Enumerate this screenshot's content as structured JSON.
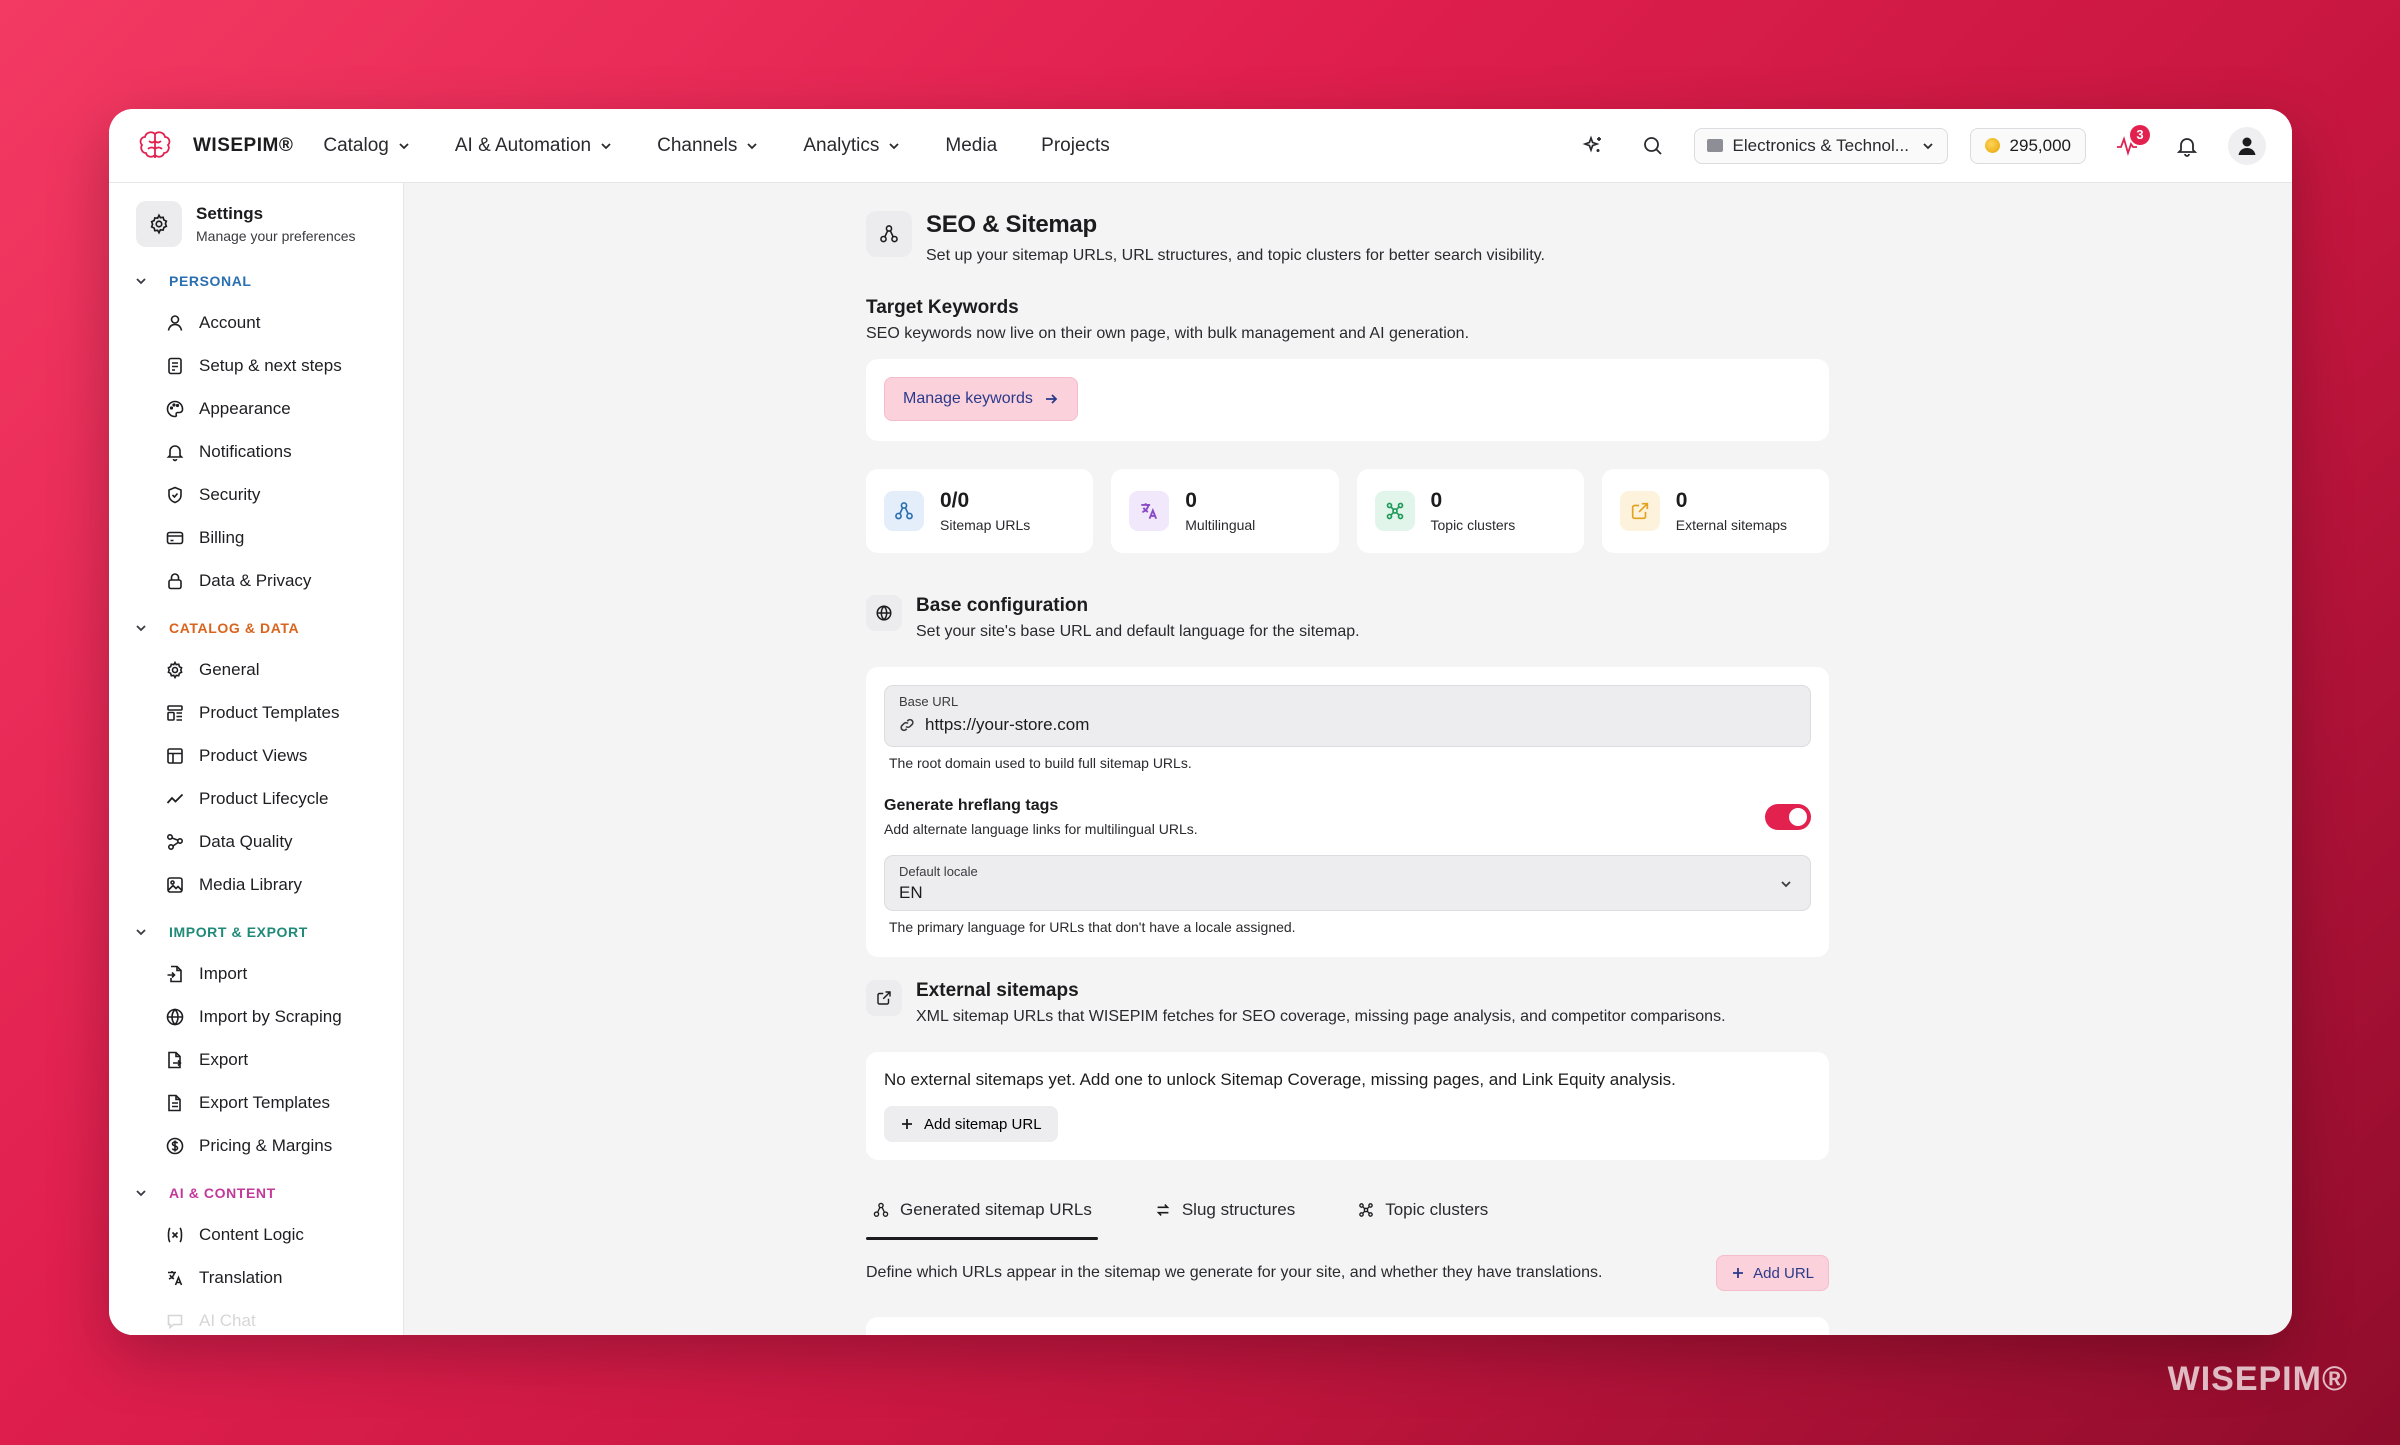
{
  "brand": {
    "name": "WISEPIM",
    "watermark": "WISEPIM®"
  },
  "nav": {
    "items": [
      {
        "label": "Catalog",
        "dropdown": true
      },
      {
        "label": "AI & Automation",
        "dropdown": true
      },
      {
        "label": "Channels",
        "dropdown": true
      },
      {
        "label": "Analytics",
        "dropdown": true
      },
      {
        "label": "Media",
        "dropdown": false
      },
      {
        "label": "Projects",
        "dropdown": false
      }
    ],
    "workspace": "Electronics & Technol...",
    "credits": "295,000",
    "activity_badge": "3"
  },
  "sidebar": {
    "title": "Settings",
    "subtitle": "Manage your preferences",
    "groups": [
      {
        "label": "PERSONAL",
        "color": "#2a6fb0",
        "items": [
          {
            "label": "Account",
            "icon": "user-icon"
          },
          {
            "label": "Setup & next steps",
            "icon": "checklist-icon"
          },
          {
            "label": "Appearance",
            "icon": "palette-icon"
          },
          {
            "label": "Notifications",
            "icon": "bell-icon"
          },
          {
            "label": "Security",
            "icon": "shield-icon"
          },
          {
            "label": "Billing",
            "icon": "card-icon"
          },
          {
            "label": "Data & Privacy",
            "icon": "lock-icon"
          }
        ]
      },
      {
        "label": "CATALOG & DATA",
        "color": "#d9641e",
        "items": [
          {
            "label": "General",
            "icon": "gear-icon"
          },
          {
            "label": "Product Templates",
            "icon": "template-icon"
          },
          {
            "label": "Product Views",
            "icon": "table-icon"
          },
          {
            "label": "Product Lifecycle",
            "icon": "trend-icon"
          },
          {
            "label": "Data Quality",
            "icon": "nodes-icon"
          },
          {
            "label": "Media Library",
            "icon": "image-icon"
          }
        ]
      },
      {
        "label": "IMPORT & EXPORT",
        "color": "#1f8a78",
        "items": [
          {
            "label": "Import",
            "icon": "file-import-icon"
          },
          {
            "label": "Import by Scraping",
            "icon": "globe-icon"
          },
          {
            "label": "Export",
            "icon": "file-export-icon"
          },
          {
            "label": "Export Templates",
            "icon": "file-template-icon"
          },
          {
            "label": "Pricing & Margins",
            "icon": "dollar-icon"
          }
        ]
      },
      {
        "label": "AI & CONTENT",
        "color": "#c3399a",
        "items": [
          {
            "label": "Content Logic",
            "icon": "variable-icon"
          },
          {
            "label": "Translation",
            "icon": "translate-icon"
          },
          {
            "label": "AI Chat",
            "icon": "chat-icon",
            "faded": true
          }
        ]
      }
    ]
  },
  "page": {
    "title": "SEO & Sitemap",
    "subtitle": "Set up your sitemap URLs, URL structures, and topic clusters for better search visibility.",
    "keywords": {
      "title": "Target Keywords",
      "subtitle": "SEO keywords now live on their own page, with bulk management and AI generation.",
      "button": "Manage keywords"
    },
    "stats": [
      {
        "value": "0/0",
        "label": "Sitemap URLs",
        "icon": "sitemap-icon",
        "color": "#2a6fb0",
        "bg": "#e4eefa"
      },
      {
        "value": "0",
        "label": "Multilingual",
        "icon": "translate-icon",
        "color": "#8a4bc7",
        "bg": "#f1e8fb"
      },
      {
        "value": "0",
        "label": "Topic clusters",
        "icon": "cluster-icon",
        "color": "#1f9a5a",
        "bg": "#e2f5ea"
      },
      {
        "value": "0",
        "label": "External sitemaps",
        "icon": "external-link-icon",
        "color": "#e2a21c",
        "bg": "#fdf3dc"
      }
    ],
    "base_config": {
      "title": "Base configuration",
      "subtitle": "Set your site's base URL and default language for the sitemap.",
      "base_url_label": "Base URL",
      "base_url_value": "https://your-store.com",
      "base_url_help": "The root domain used to build full sitemap URLs.",
      "hreflang_title": "Generate hreflang tags",
      "hreflang_sub": "Add alternate language links for multilingual URLs.",
      "hreflang_on": true,
      "locale_label": "Default locale",
      "locale_value": "EN",
      "locale_help": "The primary language for URLs that don't have a locale assigned."
    },
    "external": {
      "title": "External sitemaps",
      "subtitle": "XML sitemap URLs that WISEPIM fetches for SEO coverage, missing page analysis, and competitor comparisons.",
      "empty": "No external sitemaps yet. Add one to unlock Sitemap Coverage, missing pages, and Link Equity analysis.",
      "button": "Add sitemap URL"
    },
    "tabs": [
      {
        "label": "Generated sitemap URLs",
        "active": true
      },
      {
        "label": "Slug structures",
        "active": false
      },
      {
        "label": "Topic clusters",
        "active": false
      }
    ],
    "urls_desc": "Define which URLs appear in the sitemap we generate for your site, and whether they have translations.",
    "add_url": "Add URL"
  }
}
